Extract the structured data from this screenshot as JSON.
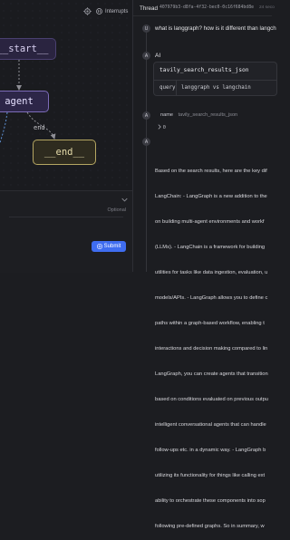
{
  "graph": {
    "toolbar": {
      "gear_icon": "gear-icon",
      "interrupts_icon": "pause-icon",
      "interrupts_label": "Interrupts"
    },
    "nodes": {
      "start": "__start__",
      "agent": "agent",
      "end": "__end__"
    },
    "edge_label": "end",
    "input_panel": {
      "optional": "Optional",
      "chevron": "chevron-down-icon"
    },
    "submit": {
      "label": "Submit",
      "icon": "plus-icon"
    }
  },
  "thread": {
    "label": "Thread",
    "id": "407979b3-d8fa-4f32-bec0-0c16f684bd8e",
    "right_text": "24 seco",
    "messages": {
      "user": {
        "badge": "U",
        "text": "what is langgraph? how is it different than langch"
      },
      "ai": {
        "badge": "A",
        "label": "AI"
      },
      "tool_call": {
        "name": "tavily_search_results_json",
        "key": "query",
        "value": "langgraph vs langchain"
      },
      "tool_result": {
        "badge": "A",
        "name_key": "name",
        "name_value": "tavily_search_results_json",
        "collapse_icon": "chevron-right-icon",
        "value": "0"
      },
      "answer": {
        "badge": "A",
        "lines": [
          "Based on the search results, here are the key dif",
          "LangChain: - LangGraph is a new addition to the",
          "on building multi-agent environments and workf",
          "(LLMs). - LangChain is a framework for building",
          "utilities for tasks like data ingestion, evaluation, u",
          "models/APIs. - LangGraph allows you to define c",
          "paths within a graph-based workflow, enabling t",
          "interactions and decision making compared to lin",
          "LangGraph, you can create agents that transition",
          "based on conditions evaluated on previous outpu",
          "intelligent conversational agents that can handle",
          "follow-ups etc. in a dynamic way. - LangGraph b",
          "utilizing its functionality for things like calling ext",
          "ability to orchestrate these components into sop",
          "following pre-defined graphs. So in summary, w"
        ]
      }
    }
  }
}
